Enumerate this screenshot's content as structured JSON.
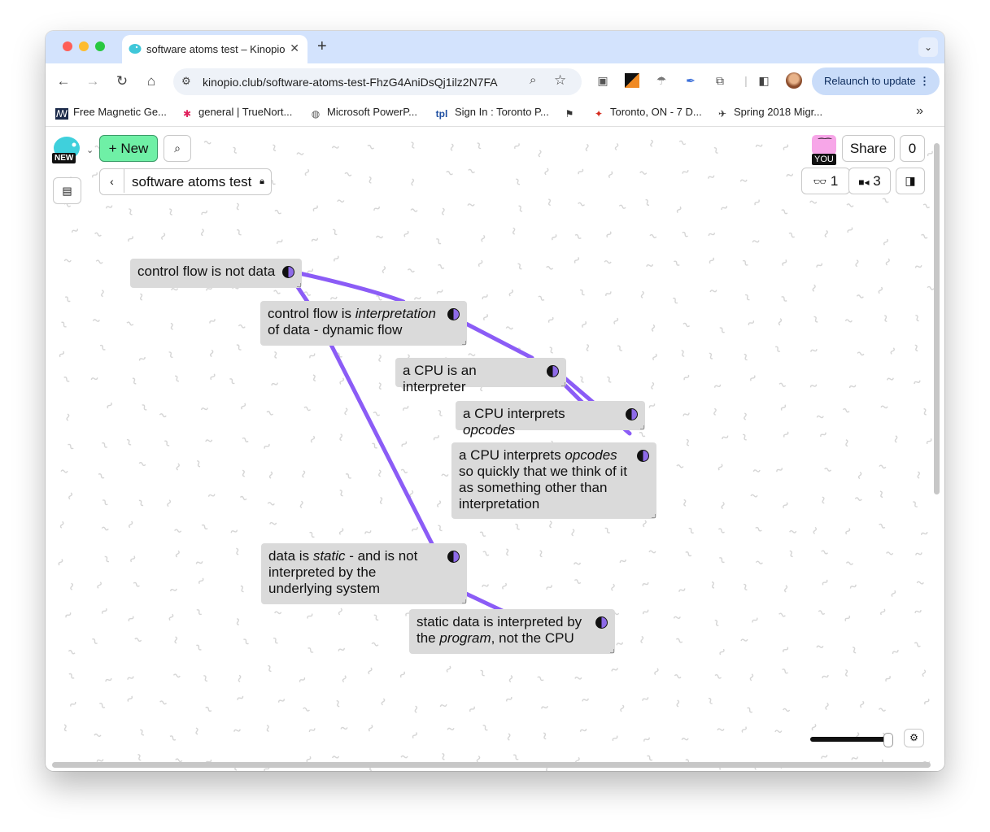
{
  "browser": {
    "tab_title": "software atoms test – Kinopio",
    "url": "kinopio.club/software-atoms-test-FhzG4AniDsQj1ilz2N7FA",
    "relaunch_label": "Relaunch to update",
    "bookmarks": [
      {
        "label": "Free Magnetic Ge...",
        "icon": "magnet-icon"
      },
      {
        "label": "general | TrueNort...",
        "icon": "slack-icon"
      },
      {
        "label": "Microsoft PowerP...",
        "icon": "globe-icon"
      },
      {
        "label": "Sign In : Toronto P...",
        "icon": "tpl-icon"
      },
      {
        "label": "",
        "icon": "flag-icon"
      },
      {
        "label": "Toronto, ON - 7 D...",
        "icon": "maple-leaf-icon"
      },
      {
        "label": "Spring 2018 Migr...",
        "icon": "bird-icon"
      }
    ]
  },
  "kinopio": {
    "new_badge": "NEW",
    "new_button": "New",
    "space_name": "software atoms test",
    "you_badge": "YOU",
    "share_label": "Share",
    "notifications_count": "0",
    "readers_count": "1",
    "collaborators_count": "3"
  },
  "cards": [
    {
      "id": "c1",
      "segments": [
        {
          "t": "control flow is not data",
          "i": false
        }
      ]
    },
    {
      "id": "c2",
      "segments": [
        {
          "t": "control flow is ",
          "i": false
        },
        {
          "t": "interpretation",
          "i": true
        },
        {
          "t": " of data - dynamic flow",
          "i": false
        }
      ]
    },
    {
      "id": "c3",
      "segments": [
        {
          "t": "a CPU is an interpreter",
          "i": false
        }
      ]
    },
    {
      "id": "c4",
      "segments": [
        {
          "t": "a CPU interprets ",
          "i": false
        },
        {
          "t": "opcodes",
          "i": true
        }
      ]
    },
    {
      "id": "c5",
      "segments": [
        {
          "t": "a CPU interprets ",
          "i": false
        },
        {
          "t": "opcodes",
          "i": true
        },
        {
          "t": " so quickly that we think of it as something other than interpretation",
          "i": false
        }
      ]
    },
    {
      "id": "c6",
      "segments": [
        {
          "t": "data is ",
          "i": false
        },
        {
          "t": "static",
          "i": true
        },
        {
          "t": " - and is not interpreted by the underlying system",
          "i": false
        }
      ]
    },
    {
      "id": "c7",
      "segments": [
        {
          "t": "static data is interpreted by the ",
          "i": false
        },
        {
          "t": "program",
          "i": true
        },
        {
          "t": ", not the CPU",
          "i": false
        }
      ]
    }
  ],
  "connection_color": "#8b5cf6",
  "zoom_level": 0.95
}
